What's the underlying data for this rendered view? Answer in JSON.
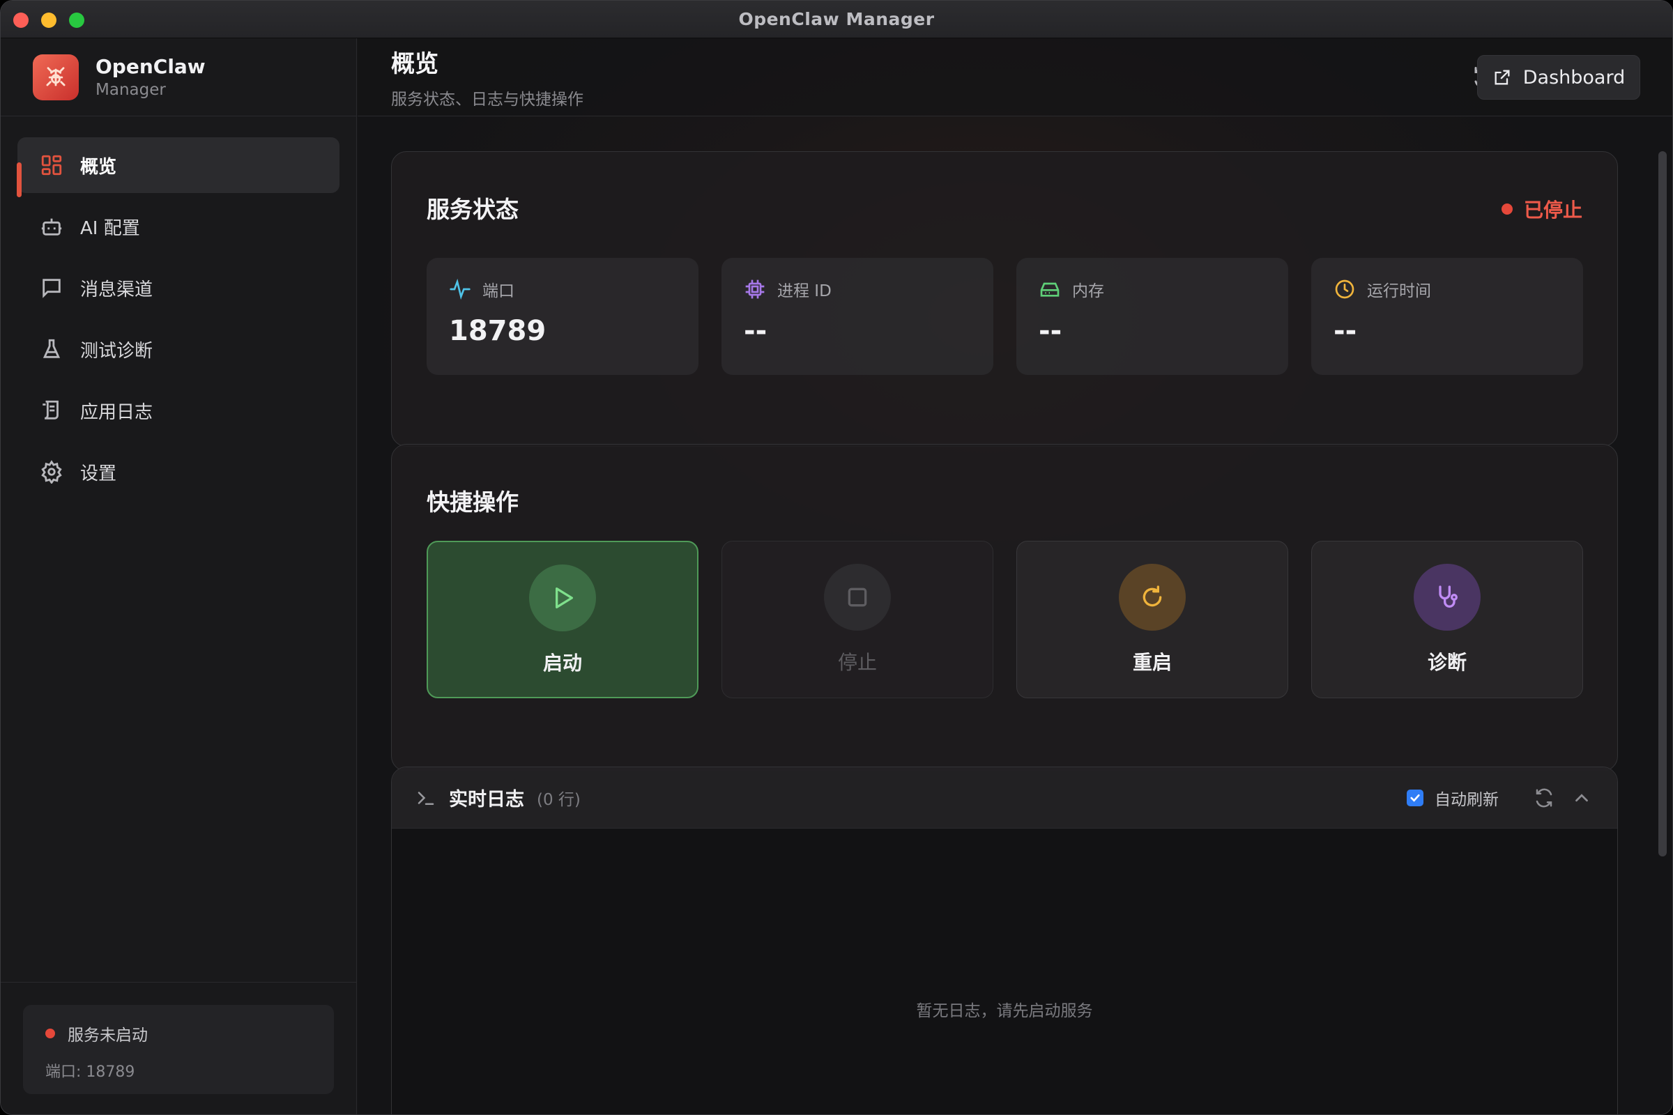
{
  "window": {
    "title": "OpenClaw Manager"
  },
  "brand": {
    "name": "OpenClaw",
    "sub": "Manager",
    "logo": "lobster-icon"
  },
  "sidebar": {
    "items": [
      {
        "label": "概览",
        "icon": "grid-icon",
        "active": true
      },
      {
        "label": "AI 配置",
        "icon": "robot-icon",
        "active": false
      },
      {
        "label": "消息渠道",
        "icon": "chat-icon",
        "active": false
      },
      {
        "label": "测试诊断",
        "icon": "flask-icon",
        "active": false
      },
      {
        "label": "应用日志",
        "icon": "scroll-icon",
        "active": false
      },
      {
        "label": "设置",
        "icon": "gear-icon",
        "active": false
      }
    ],
    "footer": {
      "status": "服务未启动",
      "port": "端口: 18789"
    }
  },
  "header": {
    "title": "概览",
    "subtitle": "服务状态、日志与快捷操作",
    "dashboard_label": "Dashboard"
  },
  "service_status": {
    "title": "服务状态",
    "badge": "已停止",
    "badge_color": "#ee5a4a",
    "stats": [
      {
        "label": "端口",
        "value": "18789",
        "icon": "activity-icon",
        "color": "#4fc3e8"
      },
      {
        "label": "进程 ID",
        "value": "--",
        "icon": "cpu-icon",
        "color": "#a678e8"
      },
      {
        "label": "内存",
        "value": "--",
        "icon": "drive-icon",
        "color": "#5fcf78"
      },
      {
        "label": "运行时间",
        "value": "--",
        "icon": "clock-icon",
        "color": "#f0b43c"
      }
    ]
  },
  "quick_actions": {
    "title": "快捷操作",
    "actions": [
      {
        "label": "启动",
        "icon": "play-icon",
        "state": "primary"
      },
      {
        "label": "停止",
        "icon": "stop-icon",
        "state": "disabled"
      },
      {
        "label": "重启",
        "icon": "restart-icon",
        "state": "normal"
      },
      {
        "label": "诊断",
        "icon": "stethoscope-icon",
        "state": "normal"
      }
    ]
  },
  "logs": {
    "title": "实时日志",
    "count": "(0 行)",
    "auto_refresh_label": "自动刷新",
    "auto_refresh_checked": true,
    "empty_text": "暂无日志，请先启动服务"
  }
}
